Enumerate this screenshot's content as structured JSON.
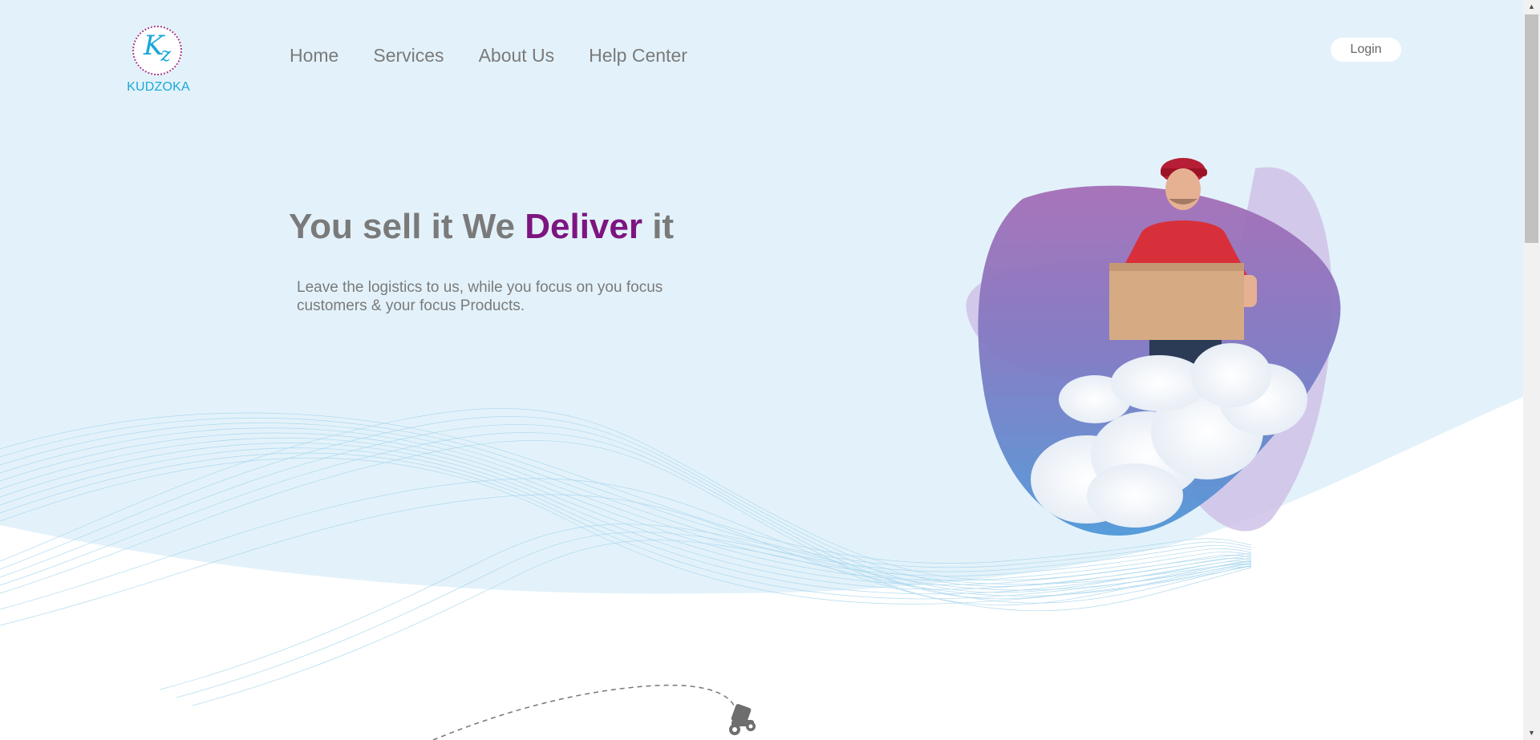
{
  "brand": {
    "logo_mark_k": "K",
    "logo_mark_z": "z",
    "name": "KUDZOKA",
    "accent_color": "#1ba8d9",
    "secondary_color": "#7d1581"
  },
  "nav": {
    "items": [
      {
        "label": "Home"
      },
      {
        "label": "Services"
      },
      {
        "label": "About Us"
      },
      {
        "label": "Help Center"
      }
    ]
  },
  "header": {
    "login_label": "Login"
  },
  "hero": {
    "title_part1": "You sell it We ",
    "title_accent": "Deliver",
    "title_part2": " it",
    "subtitle": "Leave the logistics to us, while you focus on you focus customers & your focus Products."
  },
  "icons": {
    "courier": "courier-scooter-icon",
    "scroll_up": "scroll-up-arrow-icon",
    "scroll_down": "scroll-down-arrow-icon"
  }
}
